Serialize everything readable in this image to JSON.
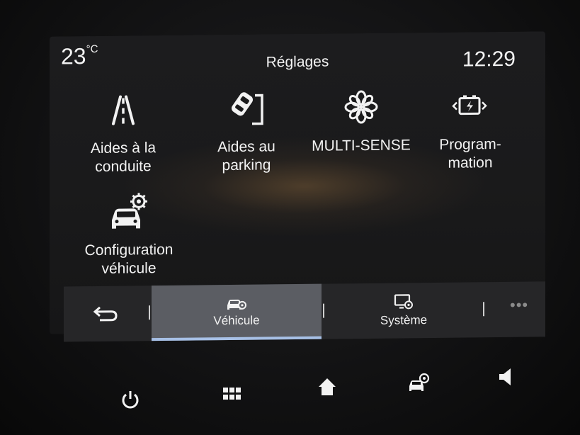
{
  "status": {
    "temperature": "23",
    "temperature_unit": "°C",
    "title": "Réglages",
    "time": "12:29"
  },
  "menu": {
    "items": [
      {
        "label": "Aides à la\nconduite",
        "icon": "road-lanes-icon"
      },
      {
        "label": "Aides au\nparking",
        "icon": "parking-car-icon"
      },
      {
        "label": "MULTI-SENSE",
        "icon": "multi-sense-flower-icon"
      },
      {
        "label": "Program-\nmation",
        "icon": "battery-charging-icon"
      },
      {
        "label": "Configuration\nvéhicule",
        "icon": "car-gear-icon"
      }
    ]
  },
  "tabs": {
    "back_icon": "back-arrow-icon",
    "items": [
      {
        "label": "Véhicule",
        "icon": "car-gear-icon",
        "active": true
      },
      {
        "label": "Système",
        "icon": "screen-gear-icon",
        "active": false
      }
    ],
    "more_label": "•••"
  },
  "hardware_buttons": [
    "power-icon",
    "apps-grid-icon",
    "home-icon",
    "car-settings-icon",
    "volume-icon"
  ]
}
